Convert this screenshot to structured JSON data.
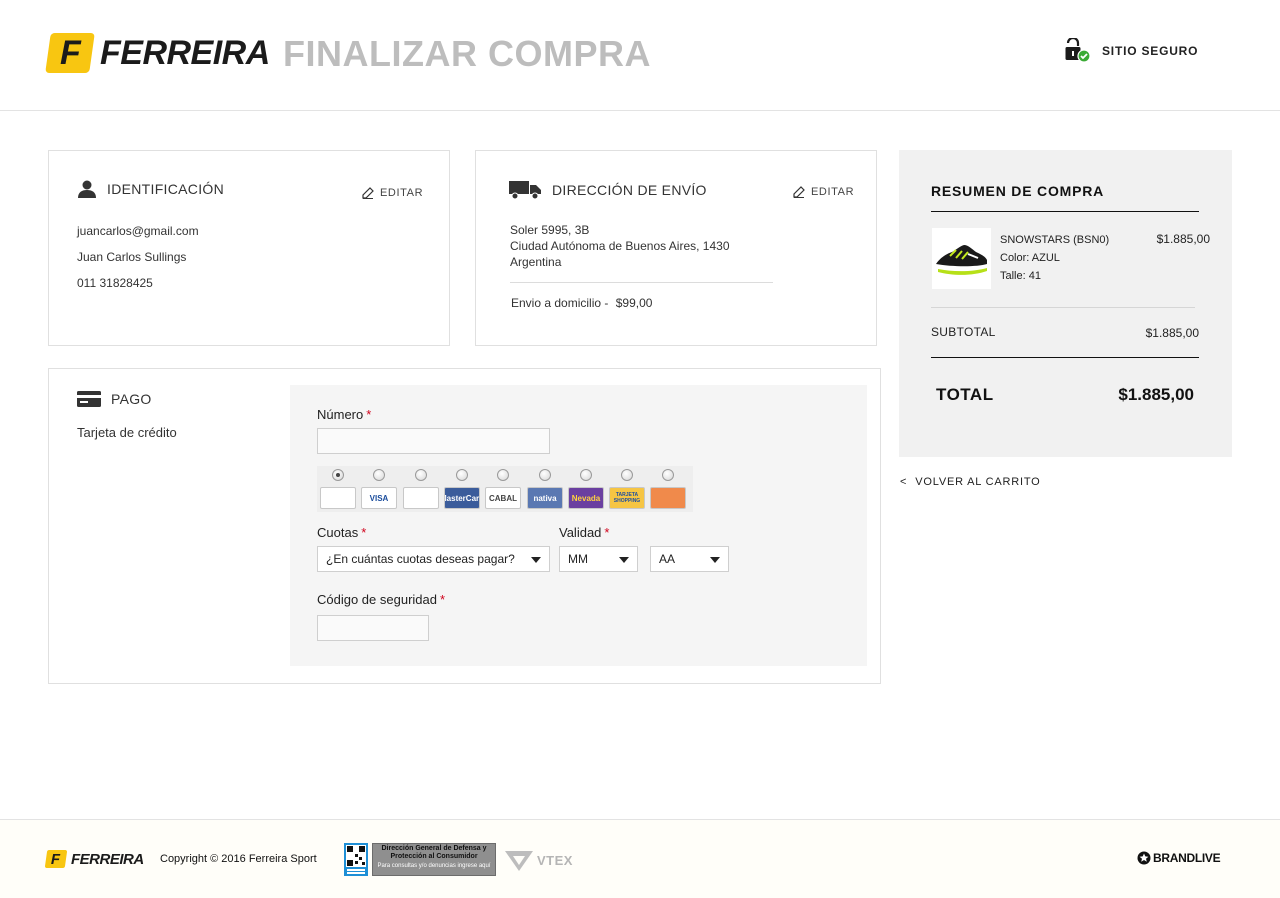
{
  "header": {
    "brand": "FERREIRA",
    "brand_initial": "F",
    "page_title": "FINALIZAR COMPRA",
    "secure_label": "SITIO SEGURO"
  },
  "identification": {
    "title": "IDENTIFICACIÓN",
    "edit_label": "EDITAR",
    "email": "juancarlos@gmail.com",
    "name": "Juan Carlos Sullings",
    "phone": "011 31828425"
  },
  "shipping": {
    "title": "DIRECCIÓN DE ENVÍO",
    "edit_label": "EDITAR",
    "address_line1": "Soler 5995, 3B",
    "address_line2": "Ciudad Autónoma de Buenos Aires, 1430",
    "address_line3": "Argentina",
    "method": "Envio a domicilio -",
    "method_price": "$99,00"
  },
  "payment": {
    "title": "PAGO",
    "method": "Tarjeta de crédito",
    "number_label": "Número",
    "required_mark": "*",
    "number_value": "",
    "card_options": [
      {
        "name": "amex-card-icon",
        "label": "",
        "bg": "#ffffff",
        "fg": "#2d6db5",
        "selected": true
      },
      {
        "name": "visa-card-icon",
        "label": "VISA",
        "bg": "#ffffff",
        "fg": "#1a4c9c",
        "selected": false
      },
      {
        "name": "diners-card-icon",
        "label": "",
        "bg": "#ffffff",
        "fg": "#1c5fae",
        "selected": false
      },
      {
        "name": "mastercard-card-icon",
        "label": "MasterCard",
        "bg": "#3b5c9b",
        "fg": "#ffffff",
        "selected": false
      },
      {
        "name": "cabal-card-icon",
        "label": "CABAL",
        "bg": "#ffffff",
        "fg": "#444444",
        "selected": false
      },
      {
        "name": "nativa-card-icon",
        "label": "nativa",
        "bg": "#5a78b2",
        "fg": "#ffffff",
        "selected": false
      },
      {
        "name": "nevada-card-icon",
        "label": "Nevada",
        "bg": "#6a3fa0",
        "fg": "#ffd23f",
        "selected": false
      },
      {
        "name": "tarjeta-shopping-card-icon",
        "label": "TARJETA SHOPPING",
        "bg": "#f6c543",
        "fg": "#1e4fa0",
        "selected": false
      },
      {
        "name": "other-card-icon",
        "label": "",
        "bg": "#f08a4b",
        "fg": "#ffffff",
        "selected": false
      }
    ],
    "installments_label": "Cuotas",
    "installments_value": "¿En cuántas cuotas deseas pagar?",
    "validity_label": "Validad",
    "month_value": "MM",
    "year_value": "AA",
    "security_label": "Código de seguridad",
    "security_value": ""
  },
  "summary": {
    "title": "RESUMEN DE COMPRA",
    "product_name": "SNOWSTARS (BSN0)",
    "product_color": "Color: AZUL",
    "product_size": "Talle: 41",
    "product_price": "$1.885,00",
    "subtotal_label": "SUBTOTAL",
    "subtotal_value": "$1.885,00",
    "total_label": "TOTAL",
    "total_value": "$1.885,00"
  },
  "back_link": {
    "arrow": "<",
    "label": "VOLVER AL CARRITO"
  },
  "footer": {
    "brand": "FERREIRA",
    "brand_initial": "F",
    "copyright": "Copyright © 2016 Ferreira Sport",
    "consumer_office_title": "Dirección General de Defensa y Protección al Consumidor",
    "consumer_office_note": "Para consultas y/o denuncias ingrese aquí",
    "vtex_label": "VTEX",
    "brandlive_label": "BRANDLIVE"
  },
  "colors": {
    "brand_yellow": "#f8c611",
    "required_red": "#d0021b",
    "secure_green": "#3aaa35"
  }
}
